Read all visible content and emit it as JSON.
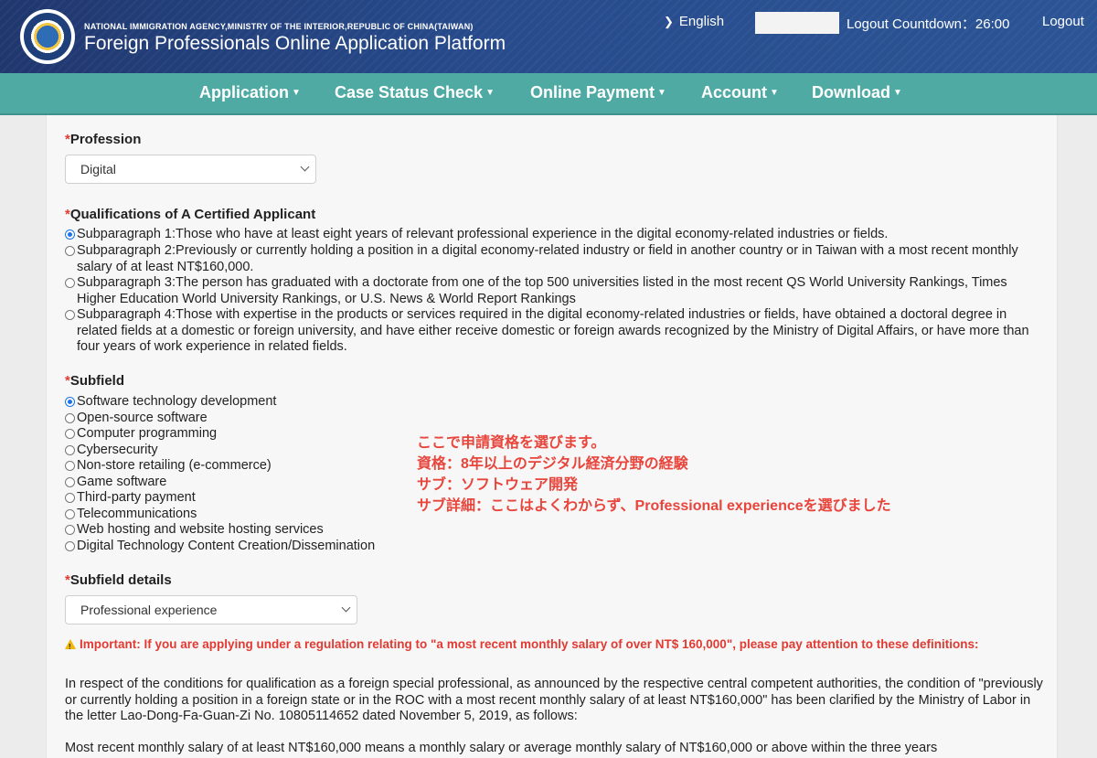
{
  "header": {
    "agency": "NATIONAL IMMIGRATION AGENCY,MINISTRY OF THE INTERIOR,REPUBLIC OF CHINA(TAIWAN)",
    "platform_title": "Foreign Professionals Online Application Platform",
    "language": "English",
    "countdown": "Logout Countdown：26:00",
    "logout": "Logout"
  },
  "nav": {
    "items": [
      {
        "label": "Application"
      },
      {
        "label": "Case Status Check"
      },
      {
        "label": "Online Payment"
      },
      {
        "label": "Account"
      },
      {
        "label": "Download"
      }
    ]
  },
  "form": {
    "profession": {
      "required_mark": "*",
      "label": "Profession",
      "value": "Digital"
    },
    "qualifications": {
      "required_mark": "*",
      "label": "Qualifications of A Certified Applicant",
      "selected_index": 0,
      "options": [
        "Subparagraph 1:Those who have at least eight years of relevant professional experience in the digital economy-related industries or fields.",
        "Subparagraph 2:Previously or currently holding a position in a digital economy-related industry or field in another country or in Taiwan with a most recent monthly salary of at least NT$160,000.",
        "Subparagraph 3:The person has graduated with a doctorate from one of the top 500 universities listed in the most recent QS World University Rankings, Times Higher Education World University Rankings, or U.S. News & World Report Rankings",
        "Subparagraph 4:Those with expertise in the products or services required in the digital economy-related industries or fields, have obtained a doctoral degree in related fields at a domestic or foreign university, and have either receive domestic or foreign awards recognized by the Ministry of Digital Affairs, or have more than four years of work experience in related fields."
      ]
    },
    "subfield": {
      "required_mark": "*",
      "label": "Subfield",
      "selected_index": 0,
      "options": [
        "Software technology development",
        "Open-source software",
        "Computer programming",
        "Cybersecurity",
        "Non-store retailing (e-commerce)",
        "Game software",
        "Third-party payment",
        "Telecommunications",
        "Web hosting and website hosting services",
        "Digital Technology Content Creation/Dissemination"
      ]
    },
    "subfield_details": {
      "required_mark": "*",
      "label": "Subfield details",
      "value": "Professional experience"
    },
    "important": "Important: If you are applying under a regulation relating to \"a most recent monthly salary of over NT$ 160,000\", please pay attention to these definitions:",
    "paragraph1": "In respect of the conditions for qualification as a foreign special professional, as announced by the respective central competent authorities, the condition of \"previously or currently holding a position in a foreign state or in the ROC with a most recent monthly salary of at least NT$160,000\" has been clarified by the Ministry of Labor in the letter Lao-Dong-Fa-Guan-Zi No. 10805114652 dated November 5, 2019, as follows:",
    "paragraph2": "Most recent monthly salary of at least NT$160,000 means a monthly salary or average monthly salary of NT$160,000 or above within the three years"
  },
  "annotation": {
    "color": "#e8453c",
    "lines": [
      "ここで申請資格を選びます。",
      "資格：8年以上のデジタル経済分野の経験",
      "サブ：ソフトウェア開発",
      "サブ詳細：ここはよくわからず、Professional experienceを選びました"
    ]
  },
  "colors": {
    "header": "#274b8c",
    "nav": "#4eaaa3",
    "required": "#e03a32",
    "radio_selected": "#1a73e8"
  }
}
